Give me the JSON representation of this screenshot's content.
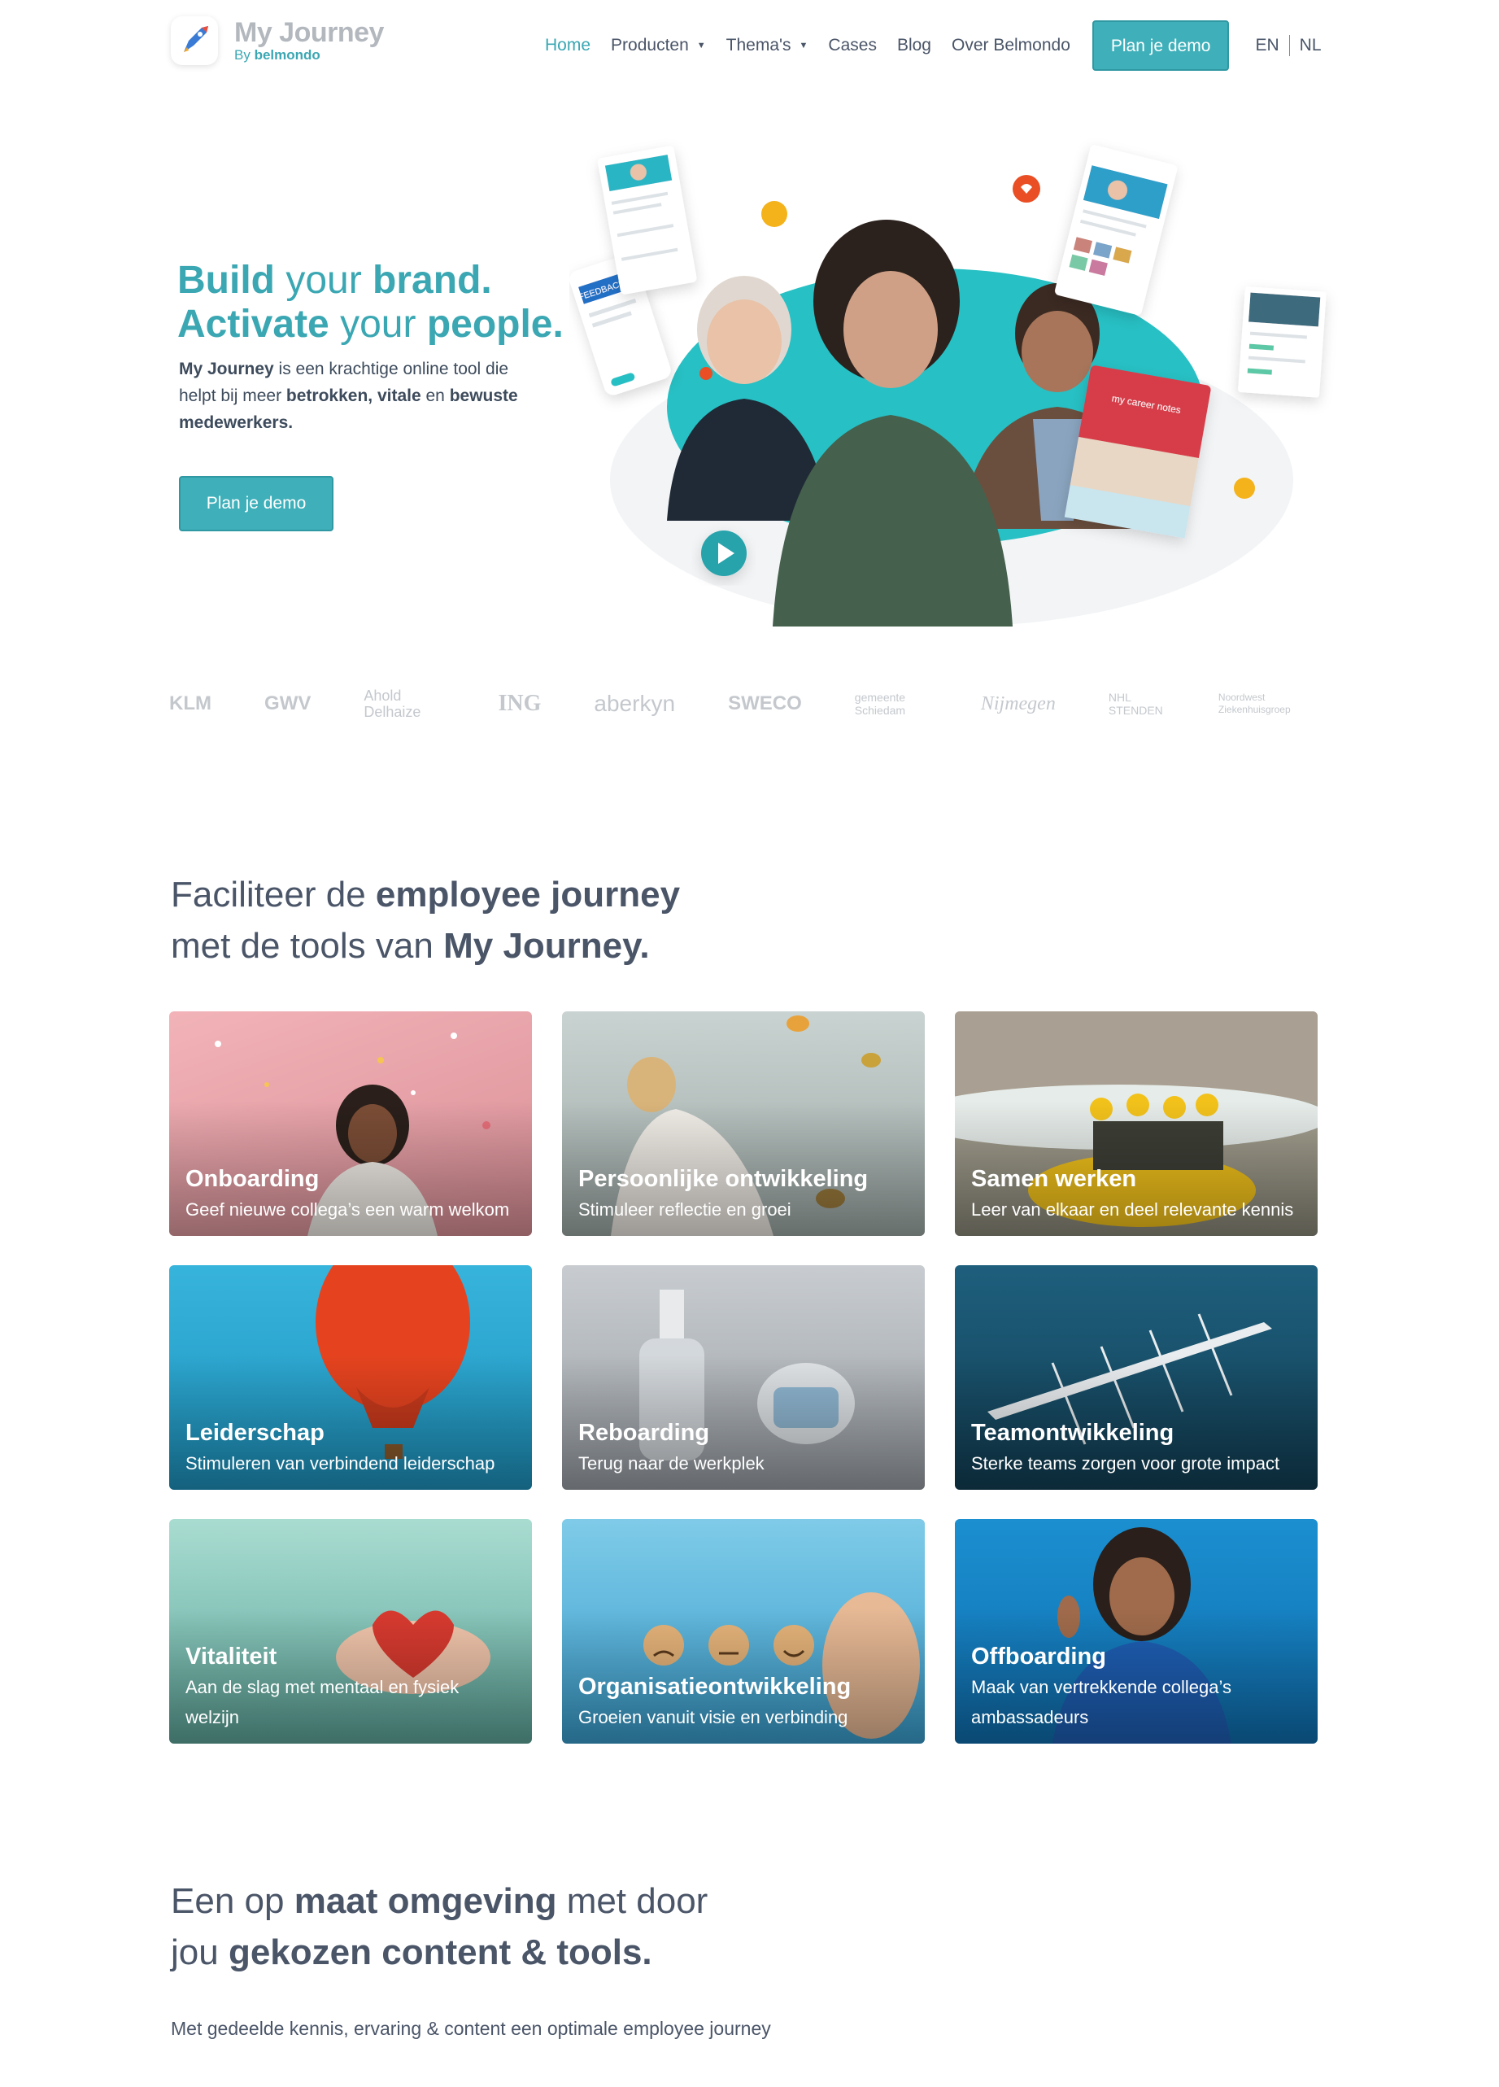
{
  "brand": {
    "title": "My Journey",
    "sub_prefix": "By",
    "sub_name": "belmondo"
  },
  "nav": {
    "items": [
      {
        "label": "Home",
        "active": true
      },
      {
        "label": "Producten",
        "dropdown": true
      },
      {
        "label": "Thema's",
        "dropdown": true
      },
      {
        "label": "Cases"
      },
      {
        "label": "Blog"
      },
      {
        "label": "Over Belmondo"
      }
    ],
    "cta": "Plan je demo",
    "languages": [
      "EN",
      "NL"
    ]
  },
  "hero": {
    "line1_a": "Build",
    "line1_b": "your",
    "line1_c": "brand.",
    "line2_a": "Activate",
    "line2_b": "your",
    "line2_c": "people.",
    "p_brand": "My Journey",
    "p_1": "is een krachtige online",
    "p_2": "tool die helpt bij meer",
    "p_bold1": "betrokken, vitale",
    "p_3": "en",
    "p_bold2": "bewuste medewerkers.",
    "button": "Plan je demo",
    "book_text": "my career notes",
    "feedback_label": "FEEDBACK"
  },
  "clients": [
    "KLM",
    "GWV",
    "Ahold Delhaize",
    "ING",
    "aberkyn",
    "SWECO",
    "gemeente Schiedam",
    "Nijmegen",
    "NHL STENDEN",
    "Noordwest Ziekenhuisgroep"
  ],
  "section1": {
    "t1": "Faciliteer de",
    "t1b": "employee journey",
    "t2": "met de tools van",
    "t2b": "My Journey."
  },
  "tiles": [
    {
      "title": "Onboarding",
      "desc": "Geef nieuwe collega’s een warm welkom",
      "bg": "#e6a7ad"
    },
    {
      "title": "Persoonlijke ontwikkeling",
      "desc": "Stimuleer reflectie en groei",
      "bg": "#b9c4c2"
    },
    {
      "title": "Samen werken",
      "desc": "Leer van elkaar en deel relevante kennis",
      "bg": "#9c9c88"
    },
    {
      "title": "Leiderschap",
      "desc": "Stimuleren van verbindend leiderschap",
      "bg": "#2fa8cf"
    },
    {
      "title": "Reboarding",
      "desc": "Terug naar de werkplek",
      "bg": "#b7bcc1"
    },
    {
      "title": "Teamontwikkeling",
      "desc": "Sterke teams zorgen voor grote impact",
      "bg": "#1a5470"
    },
    {
      "title": "Vitaliteit",
      "desc": "Aan de slag met mentaal en fysiek welzijn",
      "bg": "#7dc4b7"
    },
    {
      "title": "Organisatieontwikkeling",
      "desc": "Groeien vanuit visie en verbinding",
      "bg": "#4faed8"
    },
    {
      "title": "Offboarding",
      "desc": "Maak van vertrekkende collega’s ambassadeurs",
      "bg": "#1686c4"
    }
  ],
  "section2": {
    "t1": "Een op",
    "t1b": "maat omgeving",
    "t1c": "met door",
    "t2": "jou",
    "t2b": "gekozen content & tools.",
    "p": "Met gedeelde kennis, ervaring & content een optimale employee journey"
  },
  "colors": {
    "accent": "#3fb0ba",
    "text": "#4a5568",
    "muted": "#c4c8cd"
  }
}
